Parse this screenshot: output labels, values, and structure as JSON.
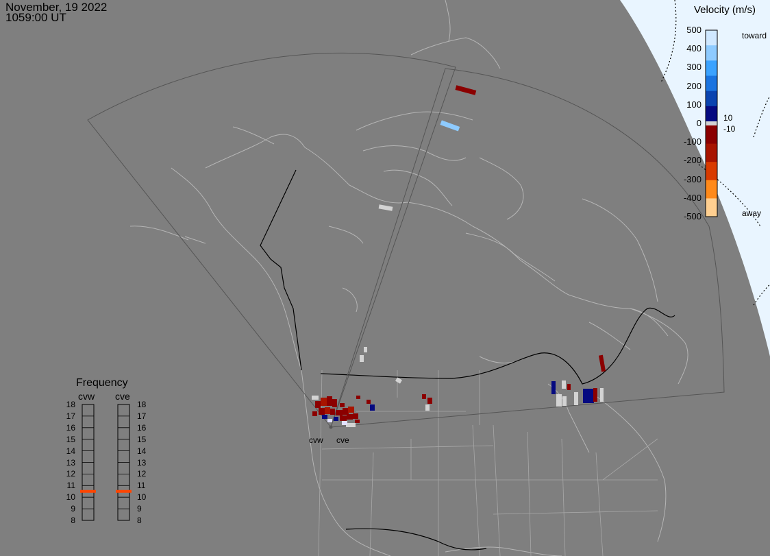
{
  "header": {
    "date": "November, 19 2022",
    "time": "1059:00 UT"
  },
  "velocity_scale": {
    "title": "Velocity (m/s)",
    "ticks": [
      "500",
      "400",
      "300",
      "200",
      "100",
      "0",
      "-100",
      "-200",
      "-300",
      "-400",
      "-500"
    ],
    "toward_label": "toward",
    "away_label": "away",
    "threshold_pos": "10",
    "threshold_neg": "-10",
    "colors": [
      "#cfe8ff",
      "#8ecbff",
      "#3ba3ff",
      "#1a74e0",
      "#0a44b0",
      "#050a80",
      "#8b0000",
      "#a81400",
      "#d93b00",
      "#ff8a1a",
      "#ffcf90"
    ]
  },
  "frequency_panel": {
    "title": "Frequency",
    "columns": [
      "cvw",
      "cve"
    ],
    "levels": [
      "18",
      "17",
      "16",
      "15",
      "14",
      "13",
      "12",
      "11",
      "10",
      "9",
      "8"
    ],
    "cvw_freq": 10.5,
    "cve_freq": 10.5,
    "marker_color": "#ff4500"
  },
  "radars": [
    "cvw",
    "cve"
  ],
  "colors": {
    "background": "#7f7f7f",
    "land_outline": "#b0b0b0",
    "fov_outline": "#505050",
    "dayside": "#e9f5ff",
    "ground_scatter": "#d3d3d3"
  }
}
